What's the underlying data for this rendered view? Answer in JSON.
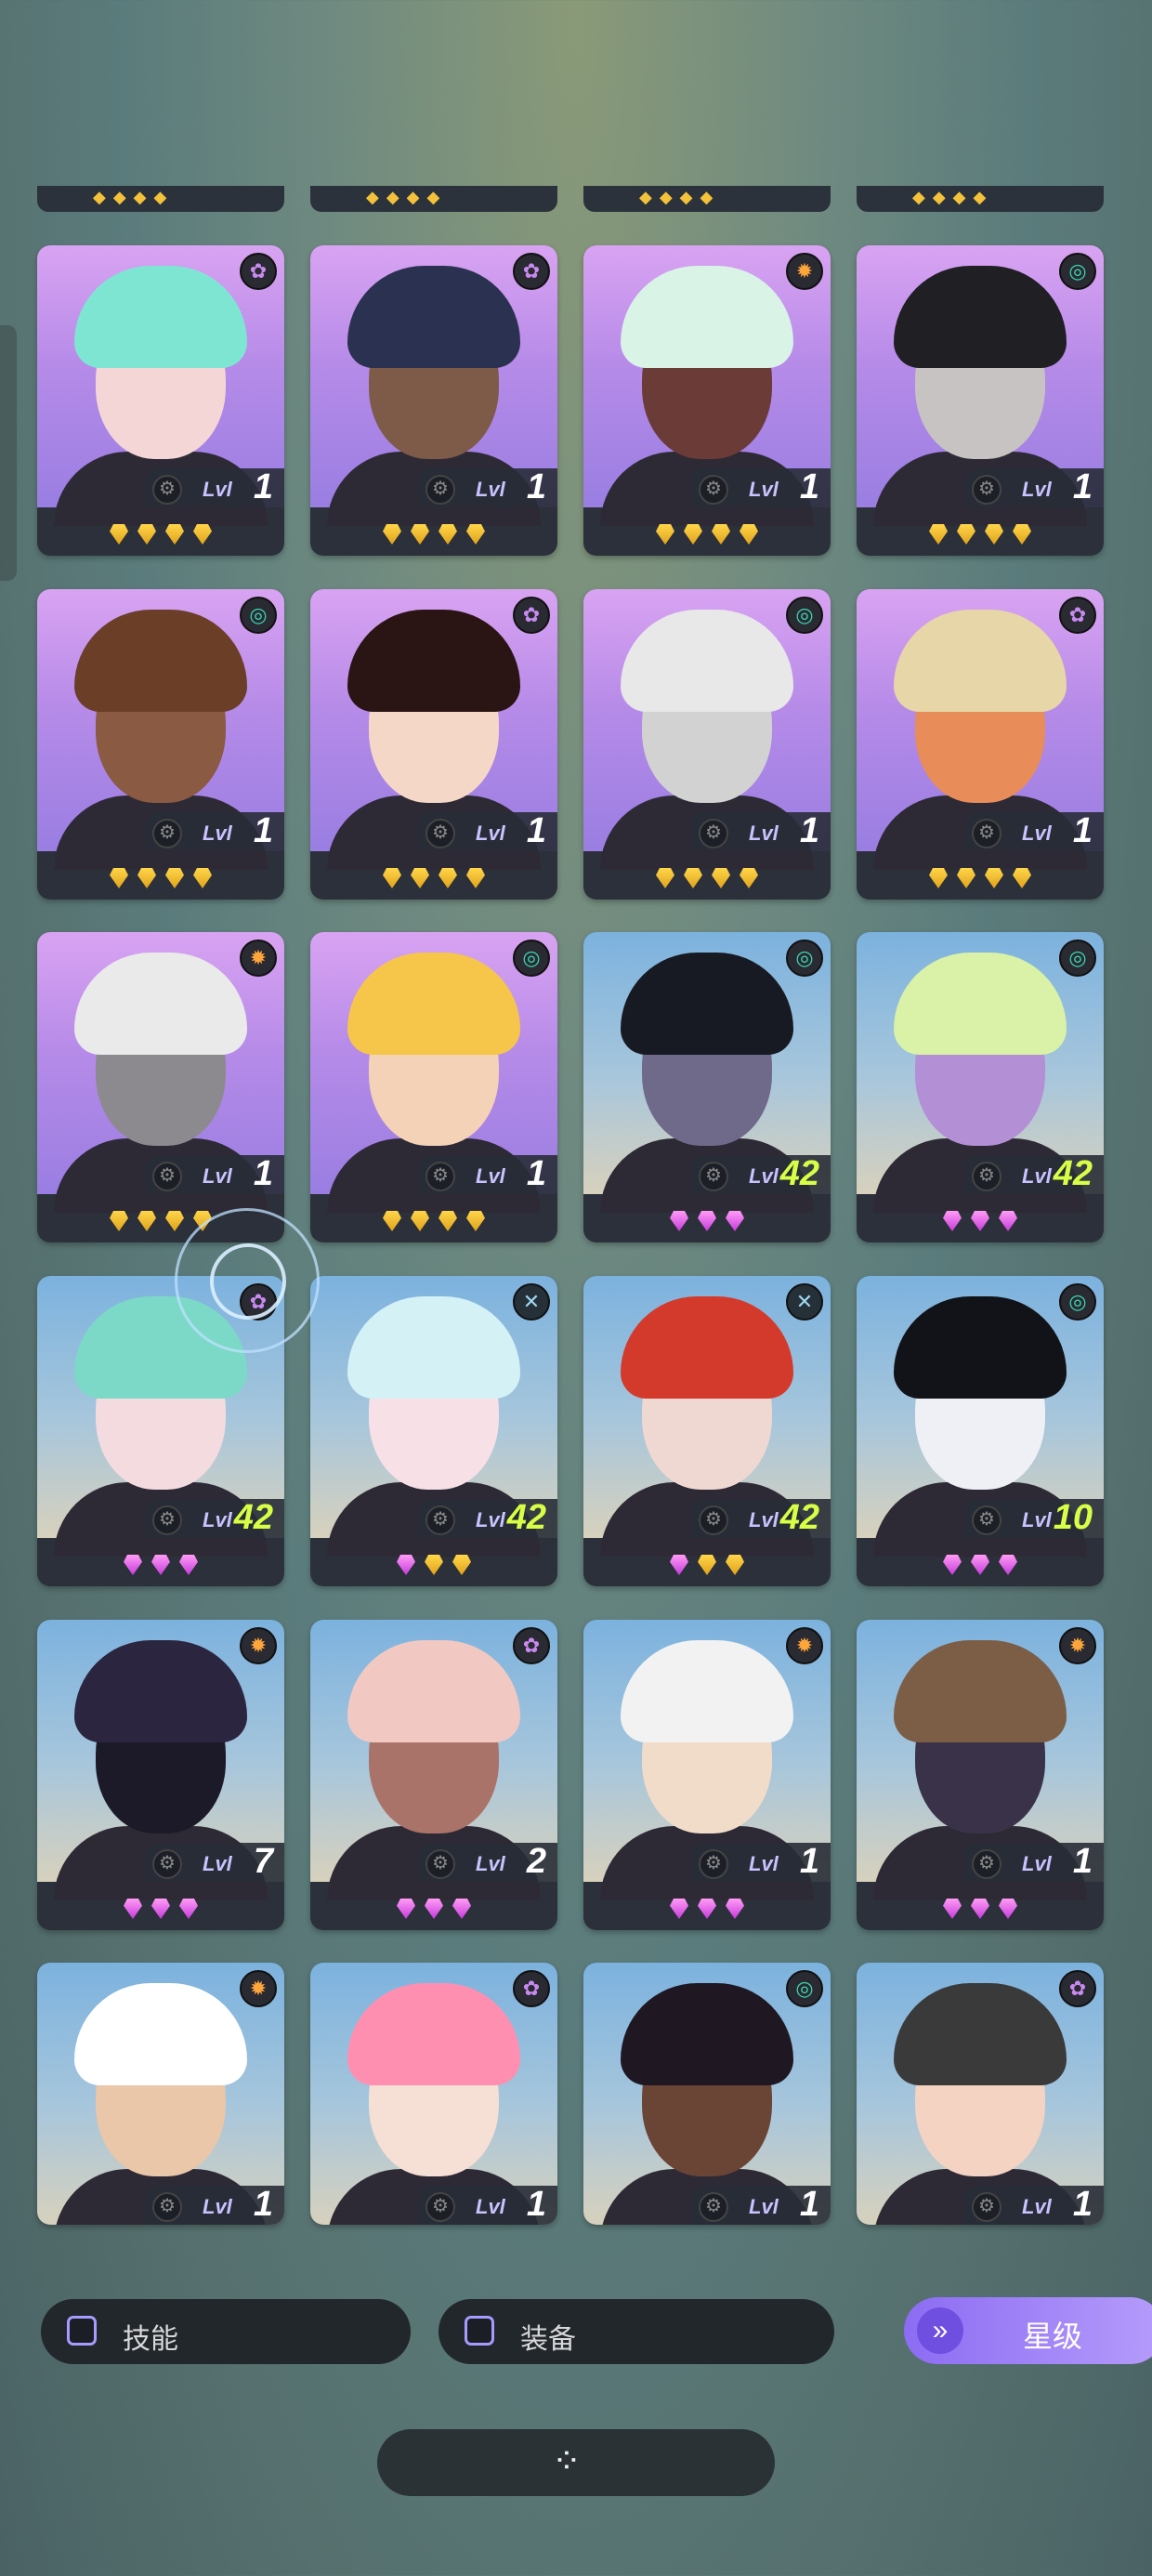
{
  "filters": {
    "skill_label": "技能",
    "equipment_label": "装备",
    "star_sort_label": "星级"
  },
  "lvl_prefix": "Lvl",
  "top_strip_gems": 4,
  "element_icons": {
    "spiral": "spiral-icon",
    "flower": "flower-icon",
    "sun": "sun-icon",
    "cross": "cross-icon"
  },
  "heroes": [
    {
      "level": "1",
      "element": "flower",
      "stars": [
        "gold",
        "gold",
        "gold",
        "gold"
      ],
      "bg": "purple",
      "hair": "#7fe5d3",
      "skin": "#f4d6d6"
    },
    {
      "level": "1",
      "element": "flower",
      "stars": [
        "gold",
        "gold",
        "gold",
        "gold"
      ],
      "bg": "purple",
      "hair": "#2b3150",
      "skin": "#7e5a48"
    },
    {
      "level": "1",
      "element": "sun",
      "stars": [
        "gold",
        "gold",
        "gold",
        "gold"
      ],
      "bg": "purple",
      "hair": "#d9f3e7",
      "skin": "#6b3b38"
    },
    {
      "level": "1",
      "element": "spiral",
      "stars": [
        "gold",
        "gold",
        "gold",
        "gold"
      ],
      "bg": "purple",
      "hair": "#1f1f24",
      "skin": "#c7c3c2"
    },
    {
      "level": "1",
      "element": "spiral",
      "stars": [
        "gold",
        "gold",
        "gold",
        "gold"
      ],
      "bg": "purple",
      "hair": "#6a3e27",
      "skin": "#8a5a43"
    },
    {
      "level": "1",
      "element": "flower",
      "stars": [
        "gold",
        "gold",
        "gold",
        "gold"
      ],
      "bg": "purple",
      "hair": "#2a1514",
      "skin": "#f5d7c8"
    },
    {
      "level": "1",
      "element": "spiral",
      "stars": [
        "gold",
        "gold",
        "gold",
        "gold"
      ],
      "bg": "purple",
      "hair": "#e8e8e8",
      "skin": "#d2d2d2"
    },
    {
      "level": "1",
      "element": "flower",
      "stars": [
        "gold",
        "gold",
        "gold",
        "gold"
      ],
      "bg": "purple",
      "hair": "#e7d6a7",
      "skin": "#e88c5a"
    },
    {
      "level": "1",
      "element": "sun",
      "stars": [
        "gold",
        "gold",
        "gold",
        "gold"
      ],
      "bg": "purple",
      "hair": "#eaeaea",
      "skin": "#8c8a8f"
    },
    {
      "level": "1",
      "element": "spiral",
      "stars": [
        "gold",
        "gold",
        "gold",
        "gold"
      ],
      "bg": "purple",
      "hair": "#f6c64a",
      "skin": "#f4d2b7"
    },
    {
      "level": "42",
      "element": "spiral",
      "stars": [
        "purple",
        "purple",
        "purple"
      ],
      "bg": "sky",
      "hair": "#171a22",
      "skin": "#6f6a8a"
    },
    {
      "level": "42",
      "element": "spiral",
      "stars": [
        "purple",
        "purple",
        "purple"
      ],
      "bg": "sky",
      "hair": "#d9f2a7",
      "skin": "#b390d6"
    },
    {
      "level": "42",
      "element": "flower",
      "stars": [
        "purple",
        "purple",
        "purple"
      ],
      "bg": "sky",
      "hair": "#7cd9c7",
      "skin": "#f4dbe0"
    },
    {
      "level": "42",
      "element": "cross",
      "stars": [
        "purple",
        "gold",
        "gold"
      ],
      "bg": "sky",
      "hair": "#d4f1f6",
      "skin": "#f7e1e7"
    },
    {
      "level": "42",
      "element": "cross",
      "stars": [
        "purple",
        "gold",
        "gold"
      ],
      "bg": "sky",
      "hair": "#d43a2b",
      "skin": "#f0d8d2"
    },
    {
      "level": "10",
      "element": "spiral",
      "stars": [
        "purple",
        "purple",
        "purple"
      ],
      "bg": "sky",
      "hair": "#111318",
      "skin": "#eef0f5"
    },
    {
      "level": "7",
      "element": "sun",
      "stars": [
        "purple",
        "purple",
        "purple"
      ],
      "bg": "sky",
      "hair": "#2b2540",
      "skin": "#1c1a28"
    },
    {
      "level": "2",
      "element": "flower",
      "stars": [
        "purple",
        "purple",
        "purple"
      ],
      "bg": "sky",
      "hair": "#f2c9c2",
      "skin": "#a9736a"
    },
    {
      "level": "1",
      "element": "sun",
      "stars": [
        "purple",
        "purple",
        "purple"
      ],
      "bg": "sky",
      "hair": "#f2f2f2",
      "skin": "#f1dcca"
    },
    {
      "level": "1",
      "element": "sun",
      "stars": [
        "purple",
        "purple",
        "purple"
      ],
      "bg": "sky",
      "hair": "#7c5d45",
      "skin": "#3a3248"
    },
    {
      "level": "1",
      "element": "sun",
      "stars": [],
      "bg": "sky",
      "hair": "#ffffff",
      "skin": "#e9c7a8"
    },
    {
      "level": "1",
      "element": "flower",
      "stars": [],
      "bg": "sky",
      "hair": "#ff8fb1",
      "skin": "#f6dfd4"
    },
    {
      "level": "1",
      "element": "spiral",
      "stars": [],
      "bg": "sky",
      "hair": "#1f1822",
      "skin": "#6a4536"
    },
    {
      "level": "1",
      "element": "flower",
      "stars": [],
      "bg": "sky",
      "hair": "#3a3a3a",
      "skin": "#f4d3c2"
    }
  ]
}
